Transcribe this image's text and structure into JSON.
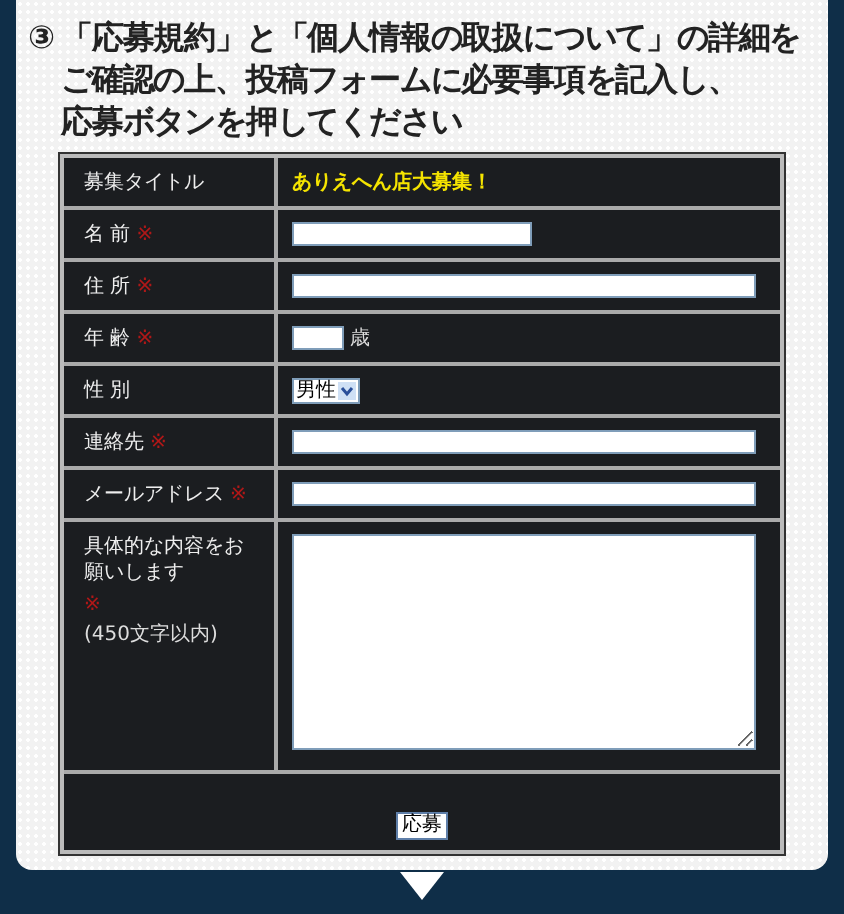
{
  "step": {
    "number": "③",
    "lines": [
      "「応募規約」と「個人情報の取扱について」の詳細を",
      "ご確認の上、投稿フォームに必要事項を記入し、",
      "応募ボタンを押してください"
    ]
  },
  "form": {
    "rows": [
      {
        "kind": "text",
        "label": "募集タイトル",
        "value": "ありえへん店大募集！"
      },
      {
        "kind": "medium_input",
        "label": "名 前",
        "required_mark": "※"
      },
      {
        "kind": "long_input",
        "label": "住 所",
        "required_mark": "※"
      },
      {
        "kind": "age",
        "label": "年 齢",
        "required_mark": "※",
        "unit": "歳"
      },
      {
        "kind": "select",
        "label": "性 別",
        "value": "男性"
      },
      {
        "kind": "long_input",
        "label": "連絡先",
        "required_mark": "※"
      },
      {
        "kind": "long_input",
        "label": "メールアドレス",
        "required_mark": "※"
      },
      {
        "kind": "textarea",
        "label": "具体的な内容をお願いします",
        "required_mark": "※",
        "note": "(450文字以内)"
      }
    ],
    "submit": "応募"
  }
}
